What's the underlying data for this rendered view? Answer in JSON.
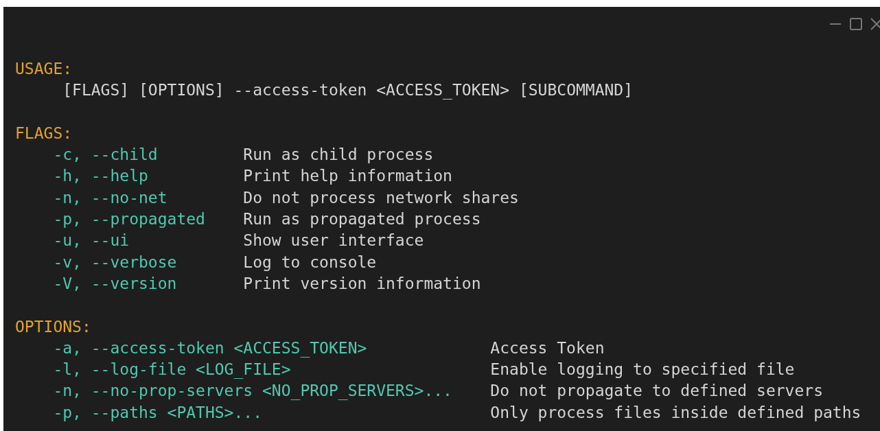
{
  "usage": {
    "heading": "USAGE:",
    "line": "[FLAGS] [OPTIONS] --access-token <ACCESS_TOKEN> [SUBCOMMAND]"
  },
  "flags": {
    "heading": "FLAGS:",
    "items": [
      {
        "flag": "-c, --child",
        "description": "Run as child process"
      },
      {
        "flag": "-h, --help",
        "description": "Print help information"
      },
      {
        "flag": "-n, --no-net",
        "description": "Do not process network shares"
      },
      {
        "flag": "-p, --propagated",
        "description": "Run as propagated process"
      },
      {
        "flag": "-u, --ui",
        "description": "Show user interface"
      },
      {
        "flag": "-v, --verbose",
        "description": "Log to console"
      },
      {
        "flag": "-V, --version",
        "description": "Print version information"
      }
    ]
  },
  "options": {
    "heading": "OPTIONS:",
    "items": [
      {
        "flag": "-a, --access-token <ACCESS_TOKEN>",
        "description": "Access Token"
      },
      {
        "flag": "-l, --log-file <LOG_FILE>",
        "description": "Enable logging to specified file"
      },
      {
        "flag": "-n, --no-prop-servers <NO_PROP_SERVERS>...",
        "description": "Do not propagate to defined servers"
      },
      {
        "flag": "-p, --paths <PATHS>...",
        "description": "Only process files inside defined paths"
      }
    ]
  }
}
